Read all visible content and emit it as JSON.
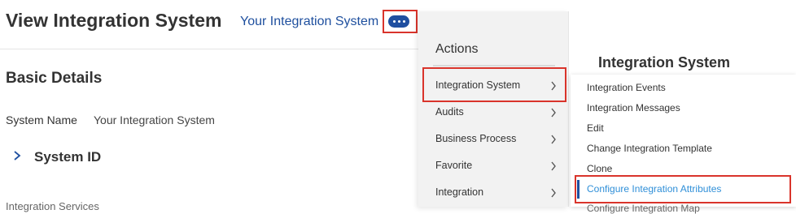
{
  "header": {
    "page_title": "View Integration System",
    "integration_link": "Your Integration System",
    "related_actions_icon": "more-horizontal-icon"
  },
  "basic_details": {
    "section_title": "Basic Details",
    "system_name_label": "System Name",
    "system_name_value": "Your Integration System",
    "system_id_label": "System ID",
    "cut_off_label": "Integration Services"
  },
  "actions_menu": {
    "title": "Actions",
    "items": [
      {
        "label": "Integration System"
      },
      {
        "label": "Audits"
      },
      {
        "label": "Business Process"
      },
      {
        "label": "Favorite"
      },
      {
        "label": "Integration"
      }
    ]
  },
  "submenu": {
    "title": "Integration System",
    "items": [
      {
        "label": "Integration Events"
      },
      {
        "label": "Integration Messages"
      },
      {
        "label": "Edit"
      },
      {
        "label": "Change Integration Template"
      },
      {
        "label": "Clone"
      },
      {
        "label": "Configure Integration Attributes"
      }
    ],
    "cut_off_item": "Configure Integration Map"
  },
  "colors": {
    "link_blue": "#1e4f9e",
    "active_item_blue": "#2f8fd8",
    "highlight_red": "#d9342b",
    "actions_panel_bg": "#f2f2f2"
  }
}
